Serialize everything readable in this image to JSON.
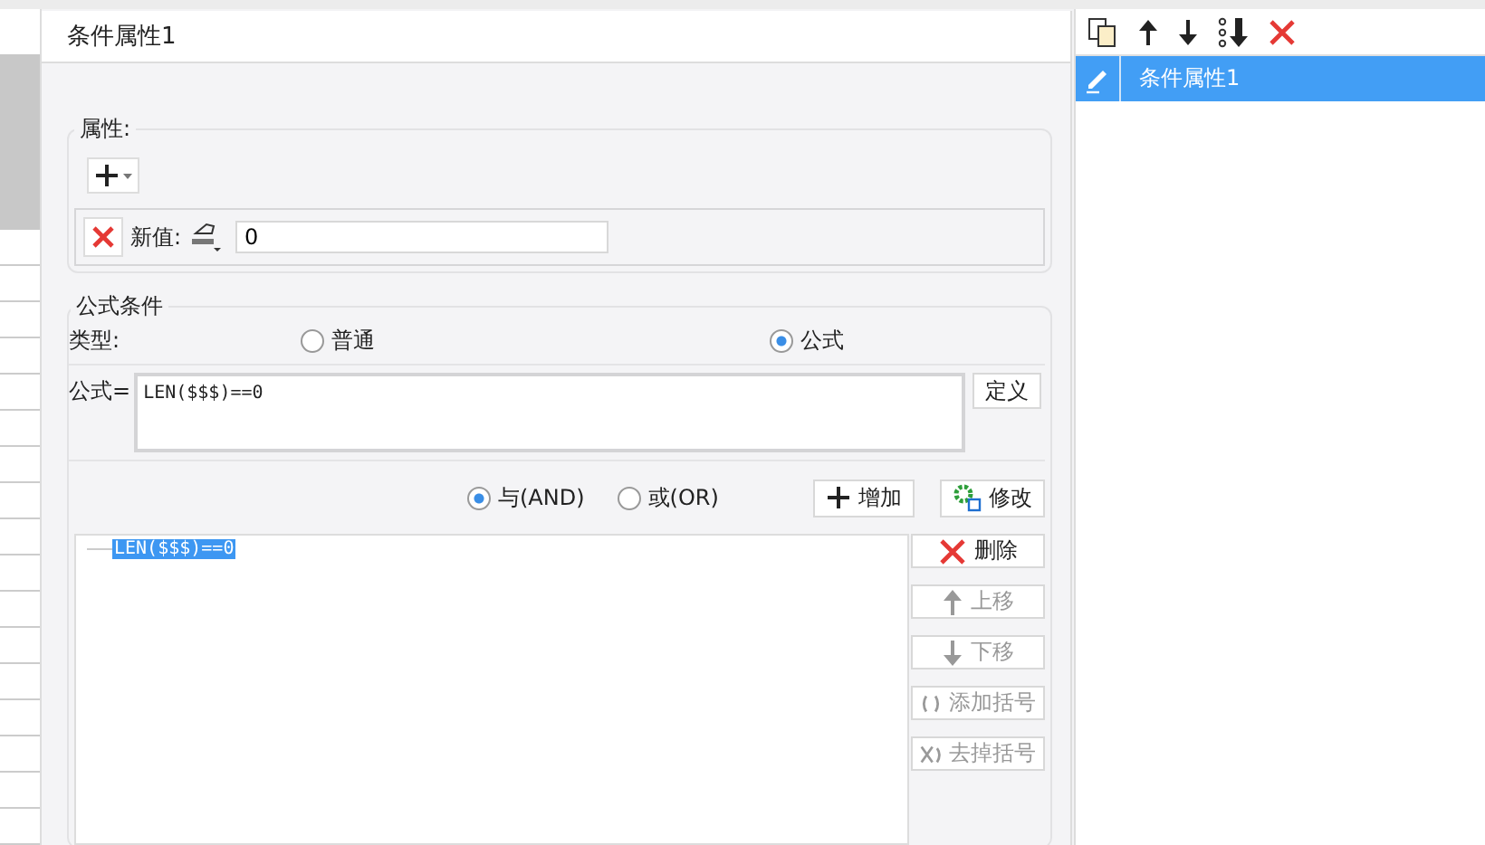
{
  "dialog": {
    "title": "条件属性1"
  },
  "attributes": {
    "legend": "属性:",
    "new_value_label": "新值:",
    "new_value": "0"
  },
  "formula_condition": {
    "legend": "公式条件",
    "type_label": "类型:",
    "types": [
      {
        "label": "普通",
        "selected": false
      },
      {
        "label": "公式",
        "selected": true
      }
    ],
    "formula_label": "公式=",
    "formula": "LEN($$$)==0",
    "define_button": "定义",
    "logic": [
      {
        "label": "与(AND)",
        "selected": true
      },
      {
        "label": "或(OR)",
        "selected": false
      }
    ],
    "add_button": "增加",
    "modify_button": "修改",
    "conditions": [
      {
        "text": "LEN($$$)==0",
        "selected": true
      }
    ],
    "actions": [
      {
        "kind": "delete",
        "label": "删除",
        "disabled": false
      },
      {
        "kind": "up",
        "label": "上移",
        "disabled": true
      },
      {
        "kind": "down",
        "label": "下移",
        "disabled": true
      },
      {
        "kind": "add-paren",
        "label": "添加括号",
        "disabled": true
      },
      {
        "kind": "remove-paren",
        "label": "去掉括号",
        "disabled": true
      }
    ]
  },
  "condition_list": {
    "items": [
      {
        "label": "条件属性1",
        "selected": true
      }
    ]
  }
}
